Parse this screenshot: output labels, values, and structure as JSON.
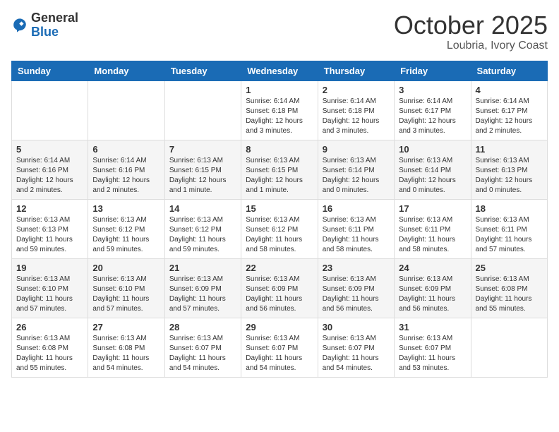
{
  "header": {
    "logo_general": "General",
    "logo_blue": "Blue",
    "month": "October 2025",
    "location": "Loubria, Ivory Coast"
  },
  "weekdays": [
    "Sunday",
    "Monday",
    "Tuesday",
    "Wednesday",
    "Thursday",
    "Friday",
    "Saturday"
  ],
  "weeks": [
    [
      {
        "day": "",
        "info": ""
      },
      {
        "day": "",
        "info": ""
      },
      {
        "day": "",
        "info": ""
      },
      {
        "day": "1",
        "info": "Sunrise: 6:14 AM\nSunset: 6:18 PM\nDaylight: 12 hours\nand 3 minutes."
      },
      {
        "day": "2",
        "info": "Sunrise: 6:14 AM\nSunset: 6:18 PM\nDaylight: 12 hours\nand 3 minutes."
      },
      {
        "day": "3",
        "info": "Sunrise: 6:14 AM\nSunset: 6:17 PM\nDaylight: 12 hours\nand 3 minutes."
      },
      {
        "day": "4",
        "info": "Sunrise: 6:14 AM\nSunset: 6:17 PM\nDaylight: 12 hours\nand 2 minutes."
      }
    ],
    [
      {
        "day": "5",
        "info": "Sunrise: 6:14 AM\nSunset: 6:16 PM\nDaylight: 12 hours\nand 2 minutes."
      },
      {
        "day": "6",
        "info": "Sunrise: 6:14 AM\nSunset: 6:16 PM\nDaylight: 12 hours\nand 2 minutes."
      },
      {
        "day": "7",
        "info": "Sunrise: 6:13 AM\nSunset: 6:15 PM\nDaylight: 12 hours\nand 1 minute."
      },
      {
        "day": "8",
        "info": "Sunrise: 6:13 AM\nSunset: 6:15 PM\nDaylight: 12 hours\nand 1 minute."
      },
      {
        "day": "9",
        "info": "Sunrise: 6:13 AM\nSunset: 6:14 PM\nDaylight: 12 hours\nand 0 minutes."
      },
      {
        "day": "10",
        "info": "Sunrise: 6:13 AM\nSunset: 6:14 PM\nDaylight: 12 hours\nand 0 minutes."
      },
      {
        "day": "11",
        "info": "Sunrise: 6:13 AM\nSunset: 6:13 PM\nDaylight: 12 hours\nand 0 minutes."
      }
    ],
    [
      {
        "day": "12",
        "info": "Sunrise: 6:13 AM\nSunset: 6:13 PM\nDaylight: 11 hours\nand 59 minutes."
      },
      {
        "day": "13",
        "info": "Sunrise: 6:13 AM\nSunset: 6:12 PM\nDaylight: 11 hours\nand 59 minutes."
      },
      {
        "day": "14",
        "info": "Sunrise: 6:13 AM\nSunset: 6:12 PM\nDaylight: 11 hours\nand 59 minutes."
      },
      {
        "day": "15",
        "info": "Sunrise: 6:13 AM\nSunset: 6:12 PM\nDaylight: 11 hours\nand 58 minutes."
      },
      {
        "day": "16",
        "info": "Sunrise: 6:13 AM\nSunset: 6:11 PM\nDaylight: 11 hours\nand 58 minutes."
      },
      {
        "day": "17",
        "info": "Sunrise: 6:13 AM\nSunset: 6:11 PM\nDaylight: 11 hours\nand 58 minutes."
      },
      {
        "day": "18",
        "info": "Sunrise: 6:13 AM\nSunset: 6:11 PM\nDaylight: 11 hours\nand 57 minutes."
      }
    ],
    [
      {
        "day": "19",
        "info": "Sunrise: 6:13 AM\nSunset: 6:10 PM\nDaylight: 11 hours\nand 57 minutes."
      },
      {
        "day": "20",
        "info": "Sunrise: 6:13 AM\nSunset: 6:10 PM\nDaylight: 11 hours\nand 57 minutes."
      },
      {
        "day": "21",
        "info": "Sunrise: 6:13 AM\nSunset: 6:09 PM\nDaylight: 11 hours\nand 57 minutes."
      },
      {
        "day": "22",
        "info": "Sunrise: 6:13 AM\nSunset: 6:09 PM\nDaylight: 11 hours\nand 56 minutes."
      },
      {
        "day": "23",
        "info": "Sunrise: 6:13 AM\nSunset: 6:09 PM\nDaylight: 11 hours\nand 56 minutes."
      },
      {
        "day": "24",
        "info": "Sunrise: 6:13 AM\nSunset: 6:09 PM\nDaylight: 11 hours\nand 56 minutes."
      },
      {
        "day": "25",
        "info": "Sunrise: 6:13 AM\nSunset: 6:08 PM\nDaylight: 11 hours\nand 55 minutes."
      }
    ],
    [
      {
        "day": "26",
        "info": "Sunrise: 6:13 AM\nSunset: 6:08 PM\nDaylight: 11 hours\nand 55 minutes."
      },
      {
        "day": "27",
        "info": "Sunrise: 6:13 AM\nSunset: 6:08 PM\nDaylight: 11 hours\nand 54 minutes."
      },
      {
        "day": "28",
        "info": "Sunrise: 6:13 AM\nSunset: 6:07 PM\nDaylight: 11 hours\nand 54 minutes."
      },
      {
        "day": "29",
        "info": "Sunrise: 6:13 AM\nSunset: 6:07 PM\nDaylight: 11 hours\nand 54 minutes."
      },
      {
        "day": "30",
        "info": "Sunrise: 6:13 AM\nSunset: 6:07 PM\nDaylight: 11 hours\nand 54 minutes."
      },
      {
        "day": "31",
        "info": "Sunrise: 6:13 AM\nSunset: 6:07 PM\nDaylight: 11 hours\nand 53 minutes."
      },
      {
        "day": "",
        "info": ""
      }
    ]
  ]
}
